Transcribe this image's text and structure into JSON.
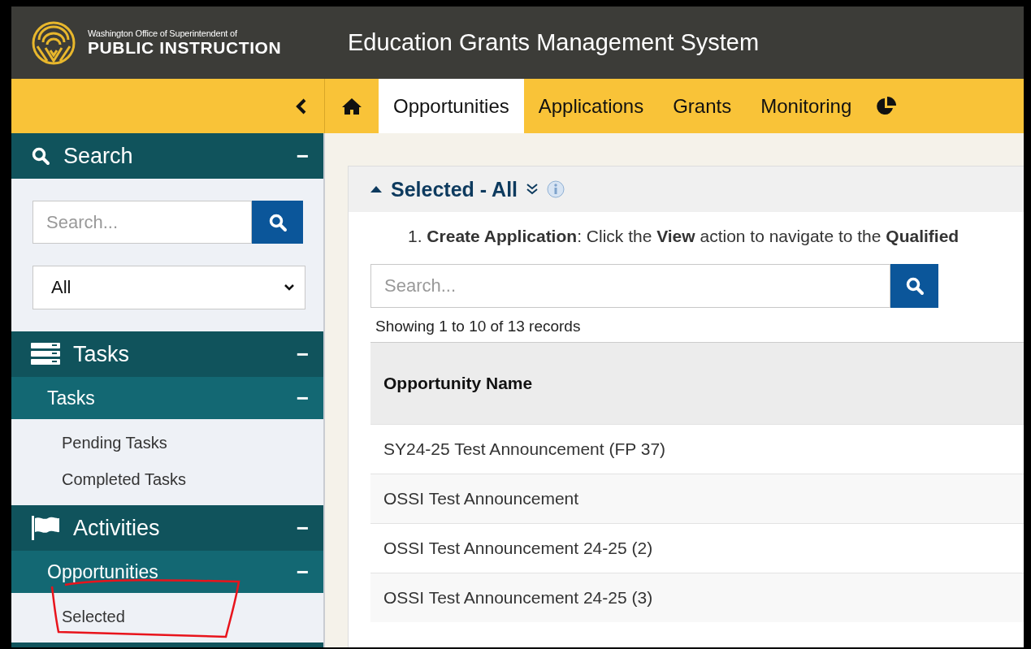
{
  "header": {
    "org_line": "Washington Office of Superintendent of",
    "org_name": "PUBLIC INSTRUCTION",
    "title": "Education Grants Management System"
  },
  "nav": {
    "tabs": [
      {
        "label": "Opportunities",
        "selected": true
      },
      {
        "label": "Applications",
        "selected": false
      },
      {
        "label": "Grants",
        "selected": false
      },
      {
        "label": "Monitoring",
        "selected": false
      }
    ]
  },
  "sidebar": {
    "sections": [
      {
        "kind": "search",
        "title": "Search",
        "toggle": "−",
        "search": {
          "placeholder": "Search..."
        },
        "filter": {
          "value": "All"
        }
      },
      {
        "kind": "tasks",
        "title": "Tasks",
        "toggle": "−",
        "groups": [
          {
            "title": "Tasks",
            "toggle": "−",
            "items": [
              "Pending Tasks",
              "Completed Tasks"
            ]
          }
        ]
      },
      {
        "kind": "activities",
        "title": "Activities",
        "toggle": "−",
        "groups": [
          {
            "title": "Opportunities",
            "toggle": "−",
            "items": [
              "Selected"
            ]
          }
        ]
      }
    ]
  },
  "panel": {
    "title": "Selected - All",
    "instruction": "1. **Create Application**: Click the **View** action to navigate to the **Qualified**",
    "search": {
      "placeholder": "Search..."
    },
    "record_count": "Showing 1 to 10 of 13 records",
    "table": {
      "columns": [
        "Opportunity Name"
      ],
      "rows": [
        [
          "SY24-25 Test Announcement (FP 37)"
        ],
        [
          "OSSI Test Announcement"
        ],
        [
          "OSSI Test Announcement 24-25 (2)"
        ],
        [
          "OSSI Test Announcement 24-25 (3)"
        ]
      ]
    }
  }
}
